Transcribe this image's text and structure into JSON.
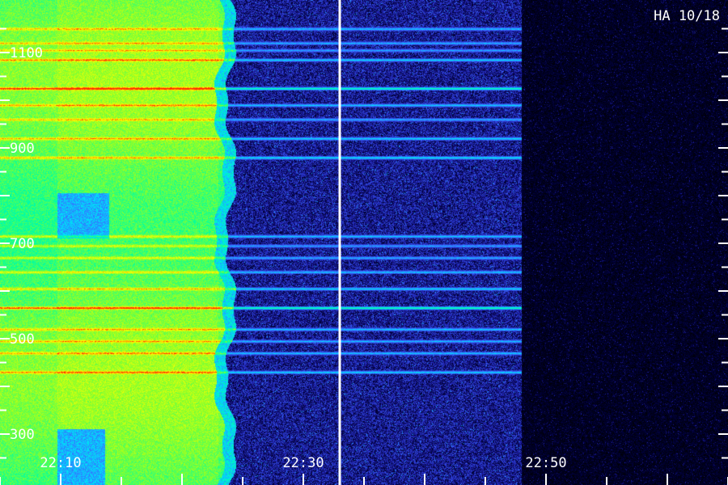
{
  "title": "HA 10/18",
  "chart_data": {
    "type": "heatmap",
    "title": "HA 10/18",
    "xlabel": "",
    "ylabel": "",
    "x_ticklabels": [
      "22:10",
      "22:30",
      "22:50"
    ],
    "y_ticklabels": [
      "300",
      "500",
      "700",
      "900",
      "1100"
    ],
    "time_range": [
      "22:05",
      "22:35"
    ],
    "y_range": [
      200,
      1200
    ],
    "colormap": [
      "#000000",
      "#000036",
      "#1e1ea8",
      "#3c64ff",
      "#00dcff",
      "#00ffa0",
      "#8cff28",
      "#ffff00",
      "#ff2800"
    ],
    "emission_end": "22:48",
    "marker_time": "22:33",
    "bright_lines": [
      {
        "y": 1150,
        "level": 0.55
      },
      {
        "y": 1120,
        "level": 0.5
      },
      {
        "y": 1105,
        "level": 0.45
      },
      {
        "y": 1085,
        "level": 0.6
      },
      {
        "y": 1025,
        "level": 0.85
      },
      {
        "y": 990,
        "level": 0.55
      },
      {
        "y": 960,
        "level": 0.5
      },
      {
        "y": 920,
        "level": 0.6
      },
      {
        "y": 880,
        "level": 0.65
      },
      {
        "y": 715,
        "level": 0.55
      },
      {
        "y": 695,
        "level": 0.45
      },
      {
        "y": 670,
        "level": 0.5
      },
      {
        "y": 640,
        "level": 0.55
      },
      {
        "y": 605,
        "level": 0.6
      },
      {
        "y": 565,
        "level": 0.9
      },
      {
        "y": 520,
        "level": 0.55
      },
      {
        "y": 495,
        "level": 0.5
      },
      {
        "y": 470,
        "level": 0.55
      },
      {
        "y": 430,
        "level": 0.6
      }
    ]
  }
}
